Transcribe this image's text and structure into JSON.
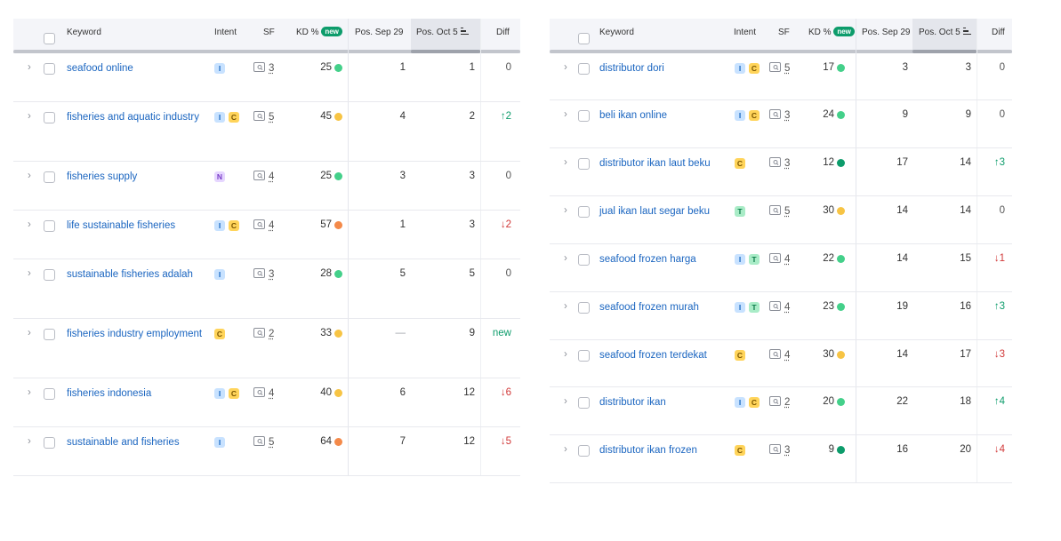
{
  "headers": {
    "keyword": "Keyword",
    "intent": "Intent",
    "sf": "SF",
    "kd": "KD %",
    "kd_badge": "new",
    "pos_prev": "Pos. Sep 29",
    "pos_curr": "Pos. Oct 5",
    "diff": "Diff"
  },
  "colors": {
    "kd_easy": "#44d08a",
    "kd_possible": "#f7c444",
    "kd_difficult": "#f48a4a",
    "kd_very_easy": "#0d9c6b"
  },
  "icons": {
    "expand": "chevron-right-icon",
    "sf": "serp-features-icon",
    "sort": "sort-descending-icon"
  },
  "left_table": [
    {
      "keyword": "seafood online",
      "intents": [
        "I"
      ],
      "sf": "3",
      "kd": "25",
      "kd_level": "easy",
      "pos_prev": "1",
      "pos_curr": "1",
      "diff": "0",
      "diff_type": "same"
    },
    {
      "keyword": "fisheries and aquatic industry",
      "intents": [
        "I",
        "C"
      ],
      "sf": "5",
      "kd": "45",
      "kd_level": "possible",
      "pos_prev": "4",
      "pos_curr": "2",
      "diff": "↑2",
      "diff_type": "up"
    },
    {
      "keyword": "fisheries supply",
      "intents": [
        "N"
      ],
      "sf": "4",
      "kd": "25",
      "kd_level": "easy",
      "pos_prev": "3",
      "pos_curr": "3",
      "diff": "0",
      "diff_type": "same"
    },
    {
      "keyword": "life sustainable fisheries",
      "intents": [
        "I",
        "C"
      ],
      "sf": "4",
      "kd": "57",
      "kd_level": "difficult",
      "pos_prev": "1",
      "pos_curr": "3",
      "diff": "↓2",
      "diff_type": "down"
    },
    {
      "keyword": "sustainable fisheries adalah",
      "intents": [
        "I"
      ],
      "sf": "3",
      "kd": "28",
      "kd_level": "easy",
      "pos_prev": "5",
      "pos_curr": "5",
      "diff": "0",
      "diff_type": "same"
    },
    {
      "keyword": "fisheries industry employment",
      "intents": [
        "C"
      ],
      "sf": "2",
      "kd": "33",
      "kd_level": "possible",
      "pos_prev": "—",
      "pos_curr": "9",
      "diff": "new",
      "diff_type": "new"
    },
    {
      "keyword": "fisheries indonesia",
      "intents": [
        "I",
        "C"
      ],
      "sf": "4",
      "kd": "40",
      "kd_level": "possible",
      "pos_prev": "6",
      "pos_curr": "12",
      "diff": "↓6",
      "diff_type": "down"
    },
    {
      "keyword": "sustainable and fisheries",
      "intents": [
        "I"
      ],
      "sf": "5",
      "kd": "64",
      "kd_level": "difficult",
      "pos_prev": "7",
      "pos_curr": "12",
      "diff": "↓5",
      "diff_type": "down"
    }
  ],
  "right_table": [
    {
      "keyword": "distributor dori",
      "intents": [
        "I",
        "C"
      ],
      "sf": "5",
      "kd": "17",
      "kd_level": "easy",
      "pos_prev": "3",
      "pos_curr": "3",
      "diff": "0",
      "diff_type": "same"
    },
    {
      "keyword": "beli ikan online",
      "intents": [
        "I",
        "C"
      ],
      "sf": "3",
      "kd": "24",
      "kd_level": "easy",
      "pos_prev": "9",
      "pos_curr": "9",
      "diff": "0",
      "diff_type": "same"
    },
    {
      "keyword": "distributor ikan laut beku",
      "intents": [
        "C"
      ],
      "sf": "3",
      "kd": "12",
      "kd_level": "very_easy",
      "pos_prev": "17",
      "pos_curr": "14",
      "diff": "↑3",
      "diff_type": "up"
    },
    {
      "keyword": "jual ikan laut segar beku",
      "intents": [
        "T"
      ],
      "sf": "5",
      "kd": "30",
      "kd_level": "possible",
      "pos_prev": "14",
      "pos_curr": "14",
      "diff": "0",
      "diff_type": "same"
    },
    {
      "keyword": "seafood frozen harga",
      "intents": [
        "I",
        "T"
      ],
      "sf": "4",
      "kd": "22",
      "kd_level": "easy",
      "pos_prev": "14",
      "pos_curr": "15",
      "diff": "↓1",
      "diff_type": "down"
    },
    {
      "keyword": "seafood frozen murah",
      "intents": [
        "I",
        "T"
      ],
      "sf": "4",
      "kd": "23",
      "kd_level": "easy",
      "pos_prev": "19",
      "pos_curr": "16",
      "diff": "↑3",
      "diff_type": "up"
    },
    {
      "keyword": "seafood frozen terdekat",
      "intents": [
        "C"
      ],
      "sf": "4",
      "kd": "30",
      "kd_level": "possible",
      "pos_prev": "14",
      "pos_curr": "17",
      "diff": "↓3",
      "diff_type": "down"
    },
    {
      "keyword": "distributor ikan",
      "intents": [
        "I",
        "C"
      ],
      "sf": "2",
      "kd": "20",
      "kd_level": "easy",
      "pos_prev": "22",
      "pos_curr": "18",
      "diff": "↑4",
      "diff_type": "up"
    },
    {
      "keyword": "distributor ikan frozen",
      "intents": [
        "C"
      ],
      "sf": "3",
      "kd": "9",
      "kd_level": "very_easy",
      "pos_prev": "16",
      "pos_curr": "20",
      "diff": "↓4",
      "diff_type": "down"
    }
  ]
}
